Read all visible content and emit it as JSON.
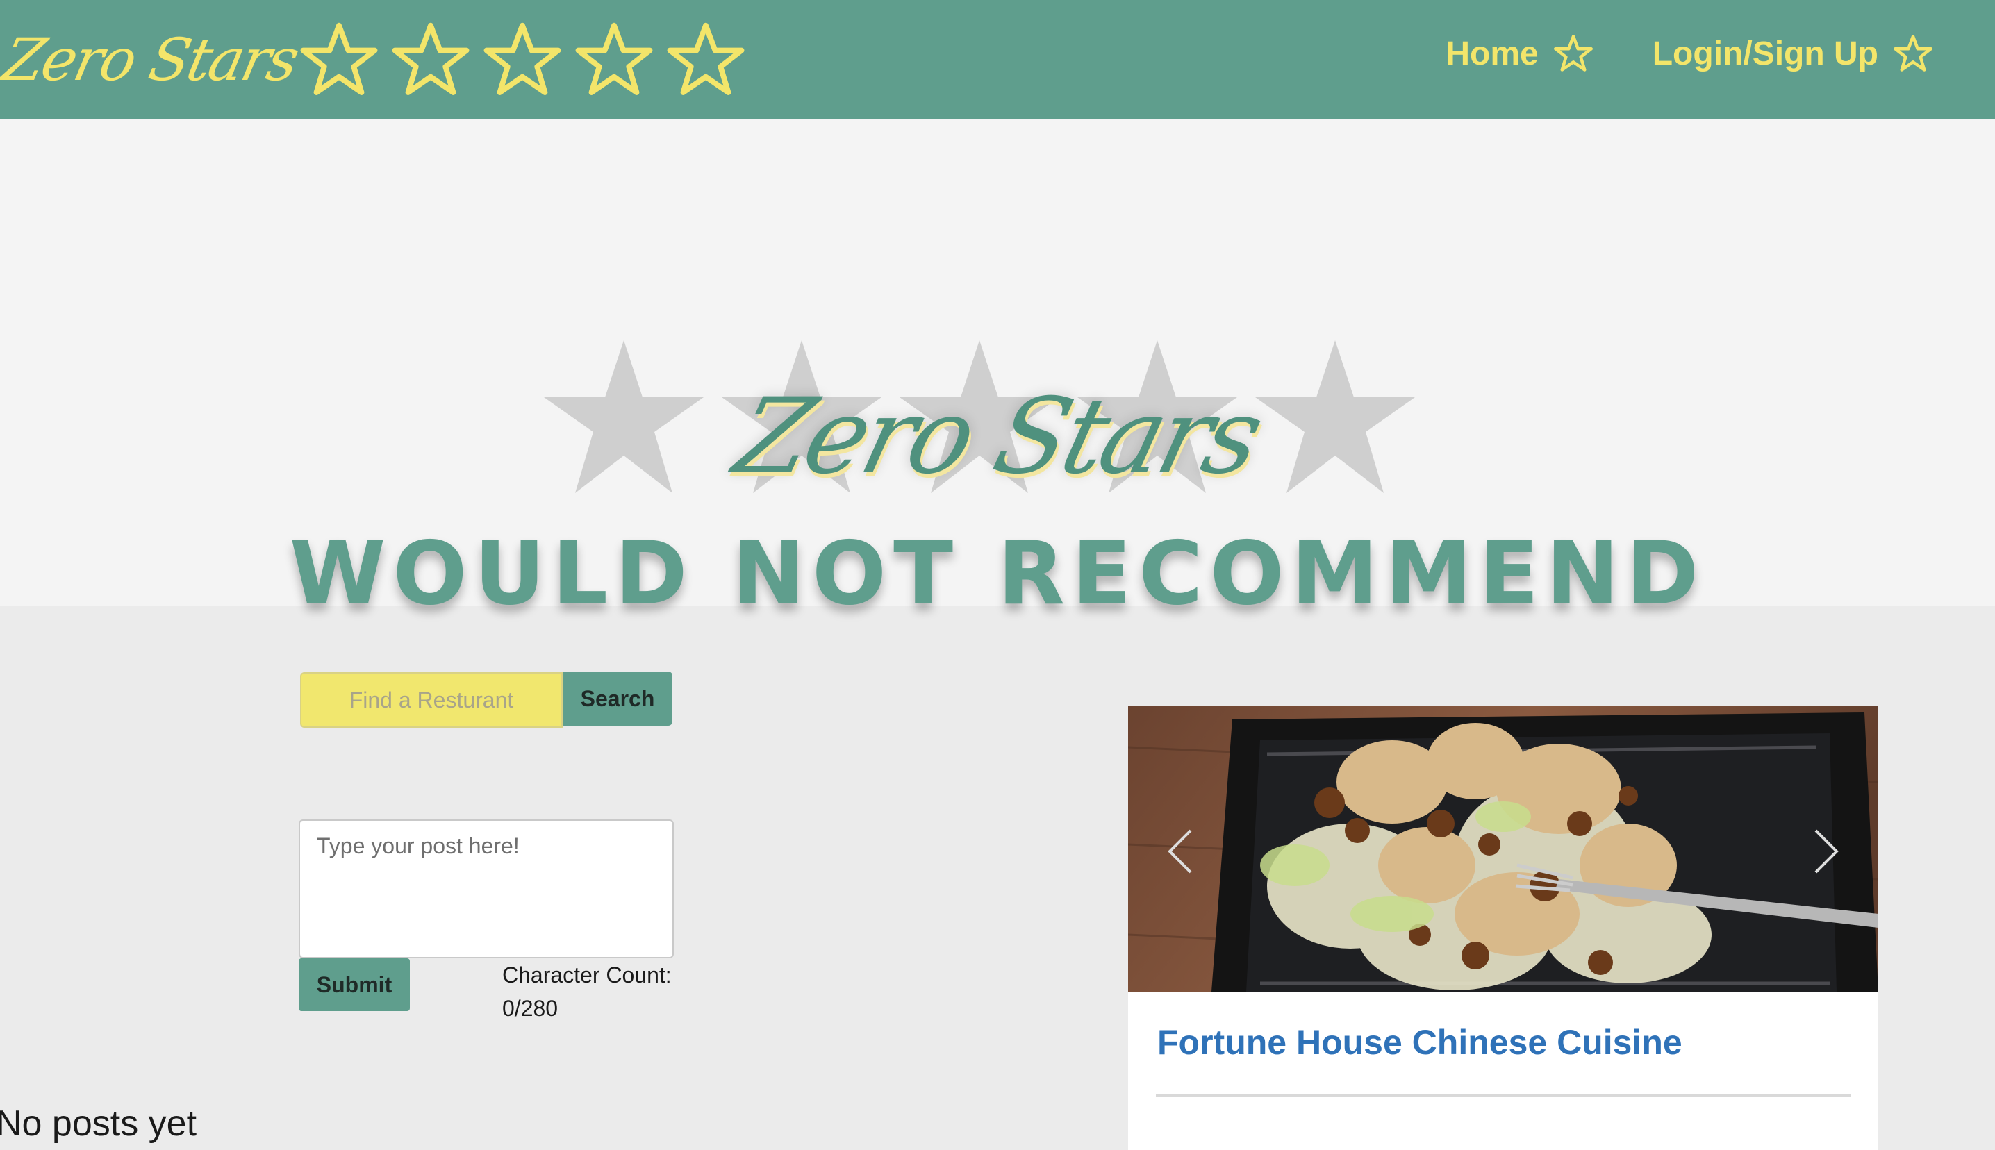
{
  "navbar": {
    "brand": "Zero Stars",
    "brand_star_count": 5,
    "links": [
      {
        "label": "Home",
        "icon": "star-outline-icon"
      },
      {
        "label": "Login/Sign Up",
        "icon": "star-outline-icon"
      }
    ]
  },
  "hero": {
    "title": "Zero Stars",
    "subtitle": "WOULD NOT RECOMMEND",
    "background_star_count": 5
  },
  "search": {
    "placeholder": "Find a Resturant",
    "button_label": "Search"
  },
  "post_form": {
    "placeholder": "Type your post here!",
    "submit_label": "Submit",
    "char_count_label": "Character Count:",
    "char_count_value": "0/280"
  },
  "posts": {
    "empty_text": "No posts yet"
  },
  "restaurant_card": {
    "name": "Fortune House Chinese Cuisine",
    "image_icon": "food-photo"
  },
  "colors": {
    "brand_green": "#5f9e8d",
    "brand_yellow": "#f3e56a",
    "link_blue": "#2f72b8",
    "star_grey": "#cfcfcf"
  }
}
